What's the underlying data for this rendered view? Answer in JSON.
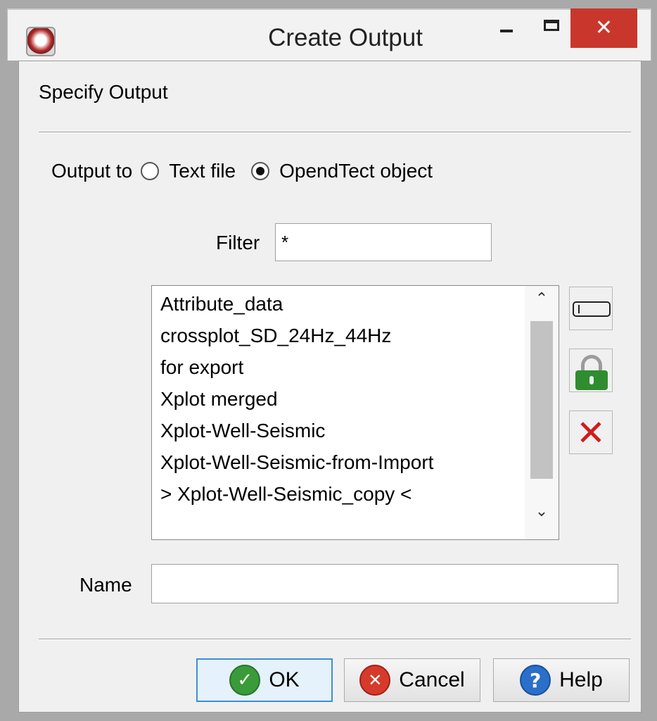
{
  "window": {
    "title": "Create Output",
    "close_glyph": "✕"
  },
  "dialog": {
    "section_label": "Specify Output",
    "output_to": {
      "label": "Output to",
      "options": [
        {
          "label": "Text file",
          "selected": false
        },
        {
          "label": "OpendTect object",
          "selected": true
        }
      ]
    },
    "filter": {
      "label": "Filter",
      "value": "*"
    },
    "objects": {
      "items": [
        "Attribute_data",
        "crossplot_SD_24Hz_44Hz",
        "for export",
        "Xplot merged",
        "Xplot-Well-Seismic",
        "Xplot-Well-Seismic-from-Import",
        "> Xplot-Well-Seismic_copy <"
      ]
    },
    "side_buttons": {
      "rename_icon": "rename-icon",
      "lock_icon": "lock-icon",
      "delete_icon": "delete-icon"
    },
    "name": {
      "label": "Name",
      "value": ""
    },
    "buttons": {
      "ok": "OK",
      "cancel": "Cancel",
      "help": "Help"
    }
  },
  "colors": {
    "close_button": "#c9372c",
    "ok_focus_border": "#3c8fd4",
    "ok_icon": "#3a9b3a",
    "cancel_icon": "#d63a2a",
    "help_icon": "#2a6fc9"
  }
}
